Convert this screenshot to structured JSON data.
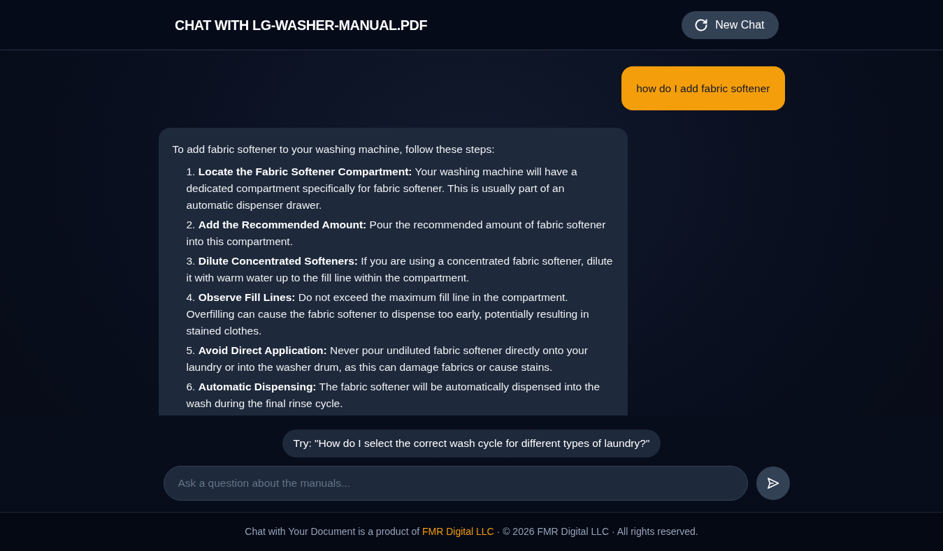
{
  "header": {
    "title": "CHAT WITH LG-WASHER-MANUAL.PDF",
    "new_chat_button": "New Chat"
  },
  "messages": [
    {
      "kind": "user",
      "text": "how do I add fabric softener"
    },
    {
      "kind": "assistant",
      "intro": "To add fabric softener to your washing machine, follow these steps:",
      "steps": [
        "1. **Locate the Fabric Softener Compartment:** Your washing machine will have a dedicated compartment specifically for fabric softener. This is usually part of an automatic dispenser drawer.",
        "2. **Add the Recommended Amount:** Pour the recommended amount of fabric softener into this compartment.",
        "3. **Dilute Concentrated Softeners:** If you are using a concentrated fabric softener, dilute it with warm water up to the fill line within the compartment.",
        "4. **Observe Fill Lines:** Do not exceed the maximum fill line in the compartment. Overfilling can cause the fabric softener to dispense too early, potentially resulting in stained clothes.",
        "5. **Avoid Direct Application:** Never pour undiluted fabric softener directly onto your laundry or into the washer drum, as this can damage fabrics or cause stains.",
        "6. **Automatic Dispensing:** The fabric softener will be automatically dispensed into the wash during the final rinse cycle."
      ]
    }
  ],
  "suggestion": "Try: \"How do I select the correct wash cycle for different types of laundry?\"",
  "input": {
    "placeholder": "Ask a question about the manuals..."
  },
  "footer": {
    "text_before": "Chat with Your Document is a product of",
    "link": "FMR Digital LLC",
    "text_after": "· © 2026 FMR Digital LLC · All rights reserved."
  }
}
